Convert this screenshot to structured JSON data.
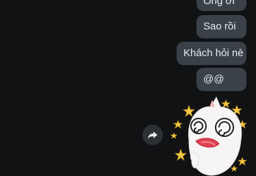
{
  "messages": [
    {
      "text": "Ông ơi"
    },
    {
      "text": "Sao rồi"
    },
    {
      "text": "Khách hỏi nè"
    },
    {
      "text": "@@"
    }
  ],
  "sticker": {
    "description_icon": "dizzy-cat-sticker-icon"
  },
  "forward_button": {
    "icon": "share-arrow-icon"
  },
  "colors": {
    "background": "#111214",
    "bubble": "#3a4149",
    "bubble_text": "#e9edf1"
  }
}
